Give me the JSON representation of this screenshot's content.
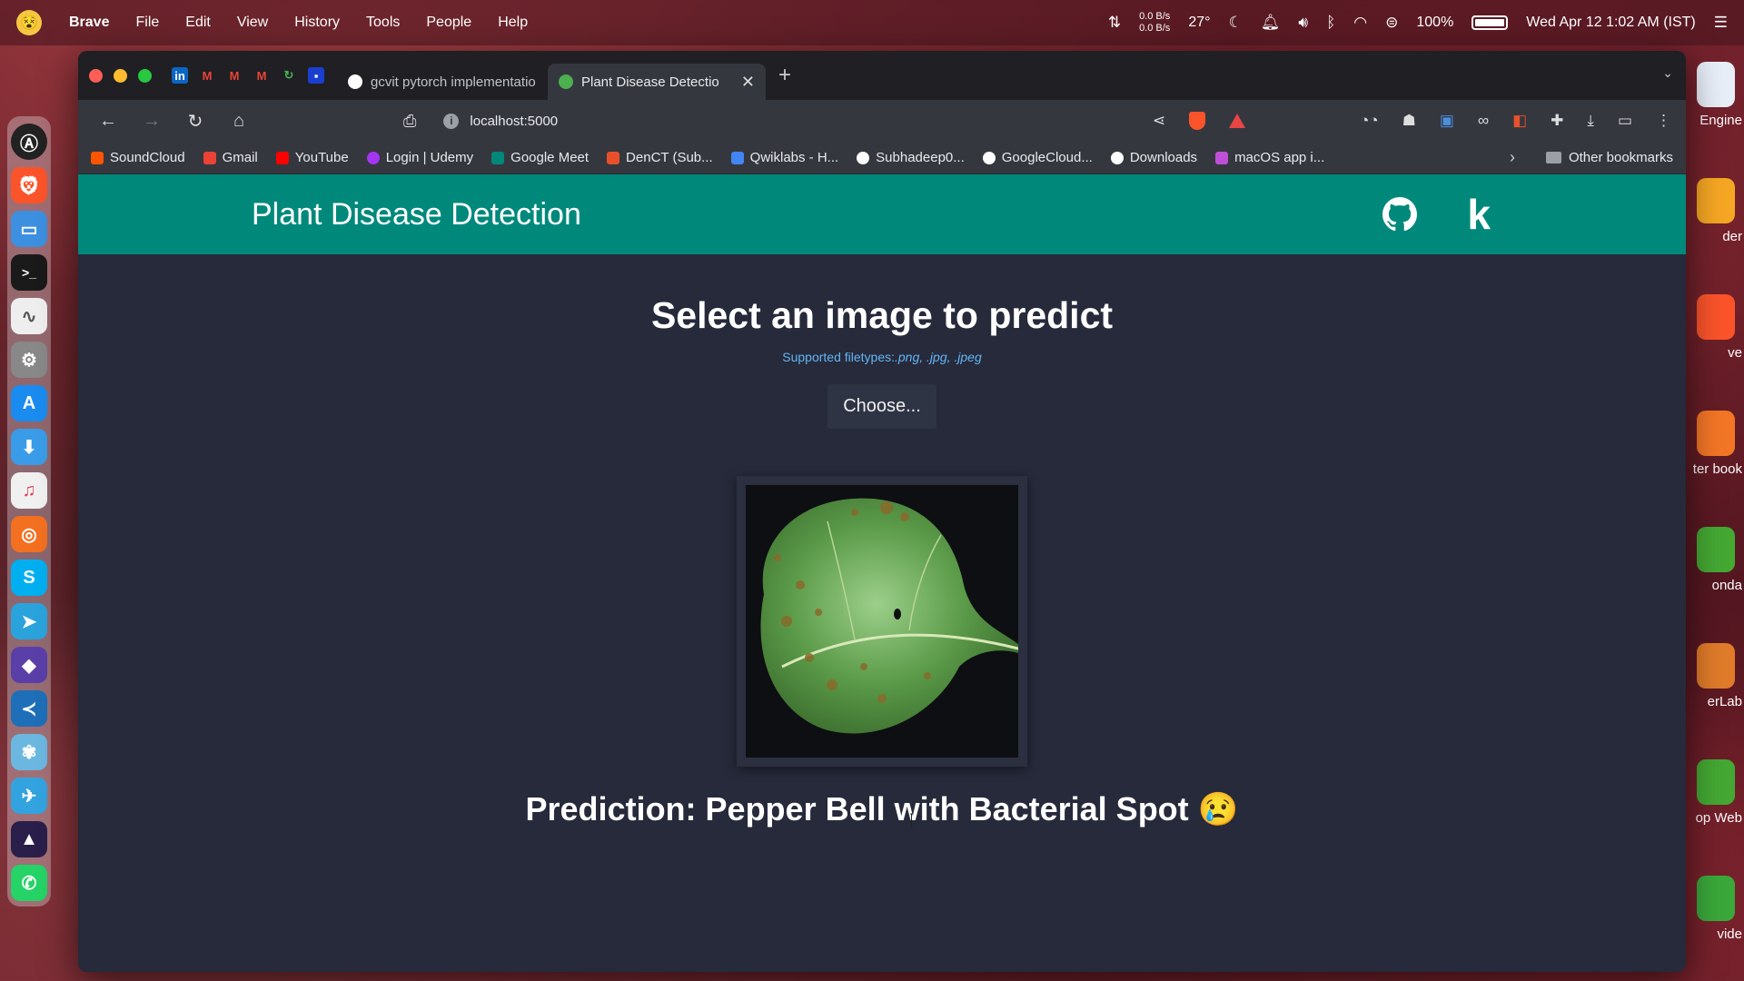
{
  "menubar": {
    "app": "Brave",
    "items": [
      "File",
      "Edit",
      "View",
      "History",
      "Tools",
      "People",
      "Help"
    ],
    "net_down": "0.0 B/s",
    "net_up": "0.0 B/s",
    "temperature": "27°",
    "battery": "100%",
    "datetime": "Wed Apr 12 1:02 AM (IST)"
  },
  "desktop_icons": [
    "Engine",
    "der",
    "ve",
    "ter book",
    "onda",
    "erLab",
    "op Web",
    "vide"
  ],
  "browser": {
    "tabs": [
      {
        "title": "gcvit pytorch implementatio",
        "active": false
      },
      {
        "title": "Plant Disease Detectio",
        "active": true
      }
    ],
    "url": "localhost:5000",
    "bookmarks": [
      "SoundCloud",
      "Gmail",
      "YouTube",
      "Login | Udemy",
      "Google Meet",
      "DenCT (Sub...",
      "Qwiklabs - H...",
      "Subhadeep0...",
      "GoogleCloud...",
      "Downloads",
      "macOS app i..."
    ],
    "other_bookmarks": "Other bookmarks"
  },
  "app": {
    "title": "Plant Disease Detection",
    "heading": "Select an image to predict",
    "filetypes_label": "Supported filetypes:",
    "filetypes_value": ".png, .jpg, .jpeg",
    "choose_label": "Choose...",
    "prediction": "Prediction: Pepper Bell with Bacterial Spot 😢"
  },
  "colors": {
    "nav_teal": "#00897b",
    "page_bg": "#262a3a",
    "link_blue": "#64b5f6"
  }
}
